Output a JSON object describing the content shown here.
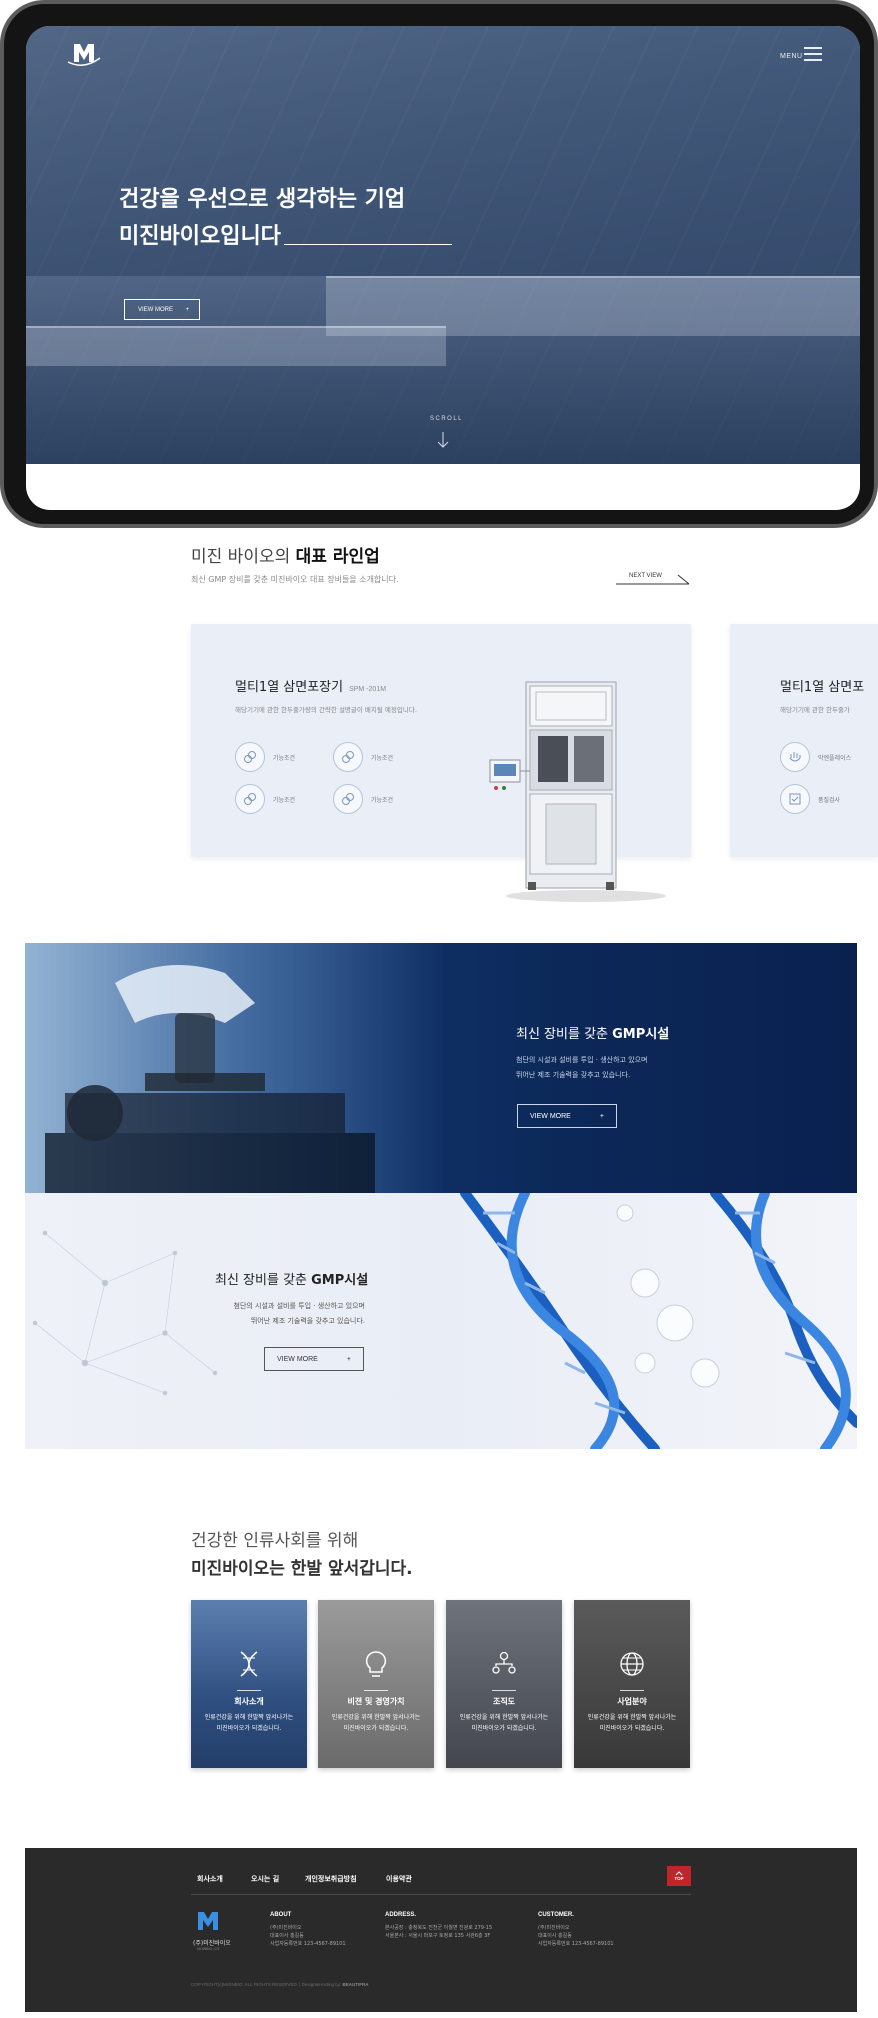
{
  "hero": {
    "menu_label": "MENU",
    "title_line1": "건강을 우선으로 생각하는 기업",
    "title_line2": "미진바이오입니다",
    "button_label": "VIEW MORE",
    "button_arrow": "+",
    "scroll_label": "SCROLL"
  },
  "lineup": {
    "title_prefix": "미진 바이오의 ",
    "title_bold": "대표 라인업",
    "subtitle": "최신 GMP 장비를 갖춘 미진바이오 대표 장비들을 소개합니다.",
    "next_view": "NEXT VIEW",
    "cards": [
      {
        "title": "멀티1열 삼면포장기",
        "model": "SPM -201M",
        "description": "해당기기에 관한 한두줄가량의 간략한 설명글이 배치될 예정입니다.",
        "features": [
          "기능조건",
          "기능조건",
          "기능조건",
          "기능조건"
        ]
      },
      {
        "title": "멀티1열 삼면포",
        "description": "해당기기에 관한 한두줄가",
        "features": [
          "막엔플레이스",
          "품질검사"
        ]
      }
    ]
  },
  "gmp_blue": {
    "title_prefix": "최신 장비를 갖춘 ",
    "title_bold": "GMP시설",
    "desc_line1": "첨단의 시설과 설비를 투입 · 생산하고 있으며",
    "desc_line2": "뛰어난 제조 기술력을 갖추고 있습니다.",
    "button_label": "VIEW MORE",
    "button_arrow": "+"
  },
  "gmp_dna": {
    "title_prefix": "최신 장비를 갖춘 ",
    "title_bold": "GMP시설",
    "desc_line1": "첨단의 시설과 설비를 투입 · 생산하고 있으며",
    "desc_line2": "뛰어난 제조 기술력을 갖추고 있습니다.",
    "button_label": "VIEW MORE",
    "button_arrow": "+"
  },
  "mission": {
    "title_line1": "건강한 인류사회를 위해",
    "title_line2": "미진바이오는 한발 앞서갑니다.",
    "tiles": [
      {
        "title": "회사소개",
        "desc1": "인류건강을 위해 한발짝 앞서나가는",
        "desc2": "미진바이오가 되겠습니다.",
        "icon": "dna-icon",
        "bg": "#2d4a78"
      },
      {
        "title": "비젼 및 경영가치",
        "desc1": "인류건강을 위해 한발짝 앞서나가는",
        "desc2": "미진바이오가 되겠습니다.",
        "icon": "lightbulb-icon",
        "bg": "#8a8a8a"
      },
      {
        "title": "조직도",
        "desc1": "인류건강을 위해 한발짝 앞서나가는",
        "desc2": "미진바이오가 되겠습니다.",
        "icon": "org-chart-icon",
        "bg": "#555a63"
      },
      {
        "title": "사업분야",
        "desc1": "인류건강을 위해 한발짝 앞서나가는",
        "desc2": "미진바이오가 되겠습니다.",
        "icon": "globe-icon",
        "bg": "#4a4a4a"
      }
    ]
  },
  "footer": {
    "nav": [
      "회사소개",
      "오시는 길",
      "개인정보취급방침",
      "이용약관"
    ],
    "top_label": "TOP",
    "logo_name": "(주)미진바이오",
    "logo_sub": "MIJINBIO.,CO",
    "about": {
      "title": "ABOUT",
      "lines": [
        "(주)미진바이오",
        "대표이사 홍길동",
        "사업자등록번호 123-4567-89101"
      ]
    },
    "address": {
      "title": "ADDRESS.",
      "lines": [
        "본사공장 : 충청북도 진천군 이월면 진광로 279-15",
        "서울본사 : 서울시 마포구 토정로 135 서관6층 3F"
      ]
    },
    "customer": {
      "title": "CUSTOMER.",
      "lines": [
        "(주)미진바이오",
        "대표이사 홍길동",
        "사업자등록번호 123-4567-89101"
      ]
    },
    "copyright": "COPYRIGHT(c)MIJINBIO. ALL RIGHTS RESERVED.  |  Design&Hosting by:",
    "copyright_brand": "BEAUTIFRA"
  }
}
